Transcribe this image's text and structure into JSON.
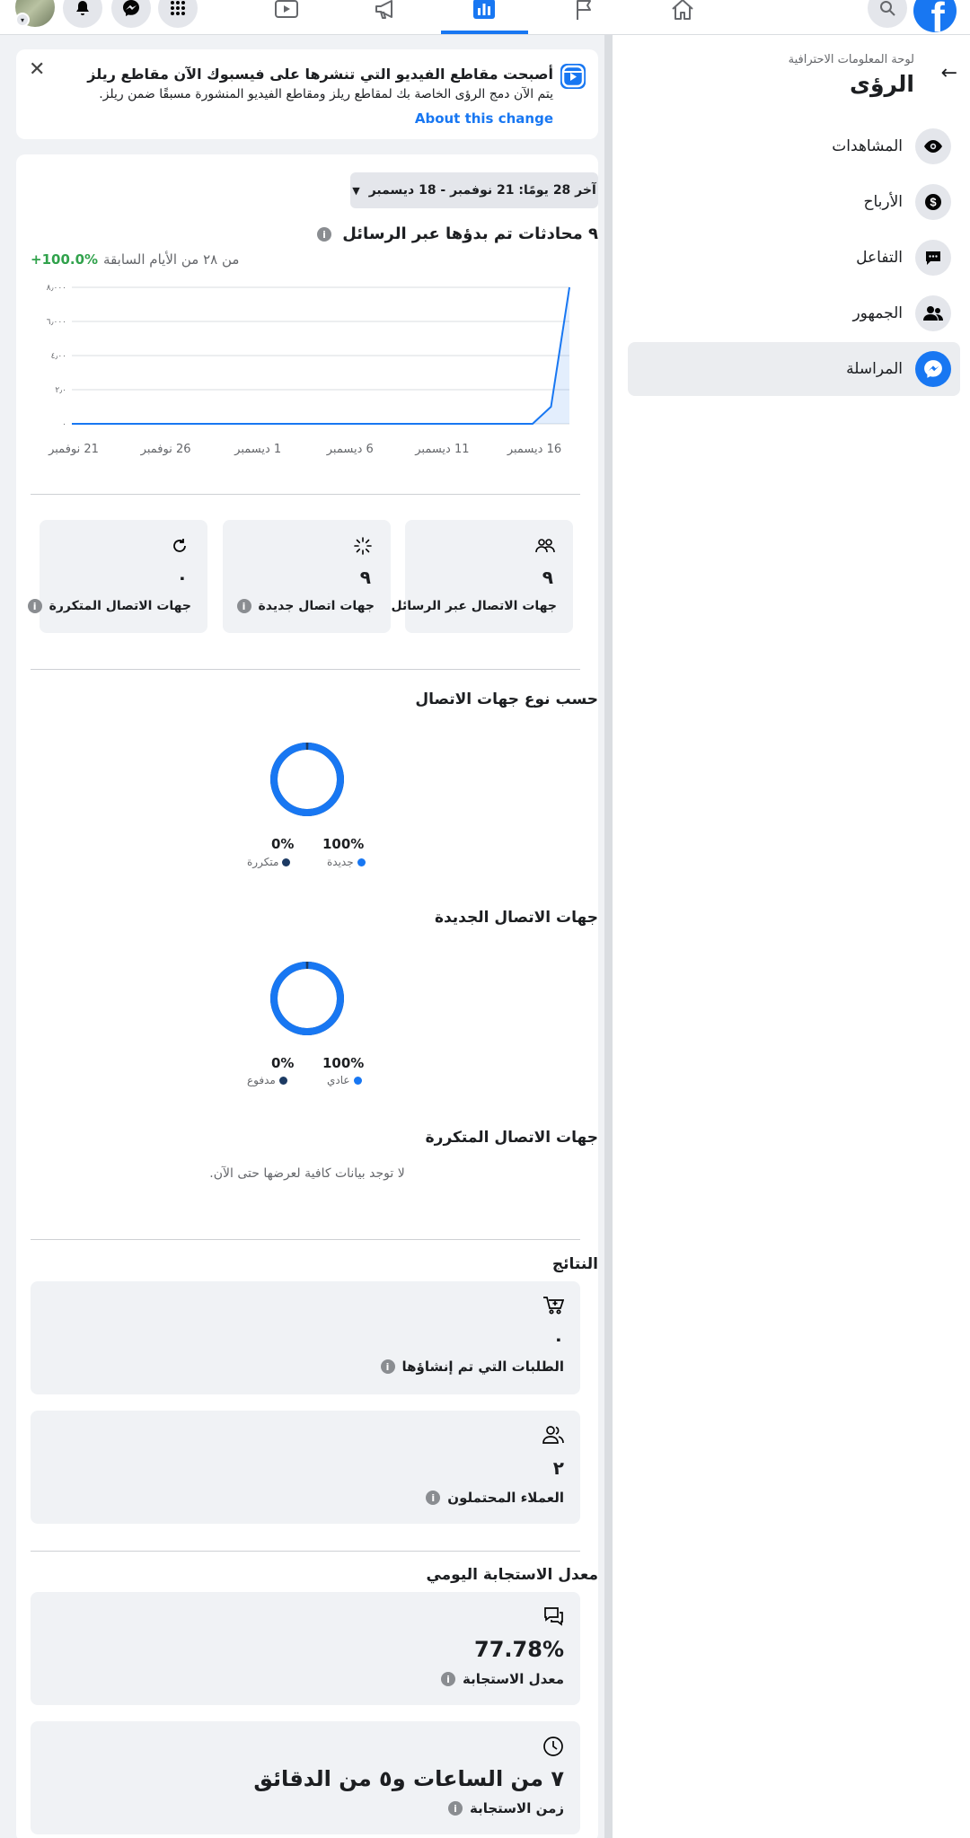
{
  "top_nav": {
    "logo": "f",
    "icons": [
      "search-icon",
      "home-icon",
      "flag-icon",
      "insights-icon",
      "megaphone-icon",
      "video-icon",
      "apps-grid-icon",
      "messenger-icon",
      "notifications-icon"
    ]
  },
  "sidebar": {
    "subtitle": "لوحة المعلومات الاحترافية",
    "title": "الرؤى",
    "items": [
      {
        "label": "المشاهدات",
        "icon": "eye-icon"
      },
      {
        "label": "الأرباح",
        "icon": "dollar-icon"
      },
      {
        "label": "التفاعل",
        "icon": "comment-icon"
      },
      {
        "label": "الجمهور",
        "icon": "people-icon"
      },
      {
        "label": "المراسلة",
        "icon": "messenger-icon"
      }
    ]
  },
  "banner": {
    "title": "أصبحت مقاطع الفيديو التي تنشرها على فيسبوك الآن مقاطع ريلز",
    "body": "يتم الآن دمج الرؤى الخاصة بك لمقاطع ريلز ومقاطع الفيديو المنشورة مسبقًا ضمن ريلز.",
    "link": "About this change"
  },
  "date_range": "آخر 28 يومًا: 21 نوفمبر - 18 ديسمبر",
  "conversations": {
    "title": "٩ محادثات تم بدؤها عبر الرسائل",
    "compare_label": "من ٢٨ من الأيام السابقة",
    "change": "+100.0%"
  },
  "chart_data": {
    "type": "line",
    "x": [
      "21 نوفمبر",
      "22",
      "23",
      "24",
      "25",
      "26 نوفمبر",
      "27",
      "28",
      "29",
      "30",
      "1 ديسمبر",
      "2",
      "3",
      "4",
      "5",
      "6 ديسمبر",
      "7",
      "8",
      "9",
      "10",
      "11 ديسمبر",
      "12",
      "13",
      "14",
      "15",
      "16 ديسمبر",
      "17",
      "18"
    ],
    "series": [
      {
        "values": [
          0,
          0,
          0,
          0,
          0,
          0,
          0,
          0,
          0,
          0,
          0,
          0,
          0,
          0,
          0,
          0,
          0,
          0,
          0,
          0,
          0,
          0,
          0,
          0,
          0,
          0,
          1,
          8
        ]
      }
    ],
    "ylim": [
      0,
      8
    ],
    "yticks": [
      "٨٫٠٠٠",
      "٦٫٠٠٠",
      "٤٫٠٠",
      "٢٫٠",
      "٠"
    ],
    "xticks": [
      "21 نوفمبر",
      "26 نوفمبر",
      "1 ديسمبر",
      "6 ديسمبر",
      "11 ديسمبر",
      "16 ديسمبر"
    ],
    "grid": true,
    "color": "#1877f2"
  },
  "stats": [
    {
      "label": "جهات الاتصال عبر الرسائل",
      "value": "٩",
      "icon": "people-group-icon"
    },
    {
      "label": "جهات اتصال جديدة",
      "value": "٩",
      "icon": "sparkle-icon"
    },
    {
      "label": "جهات الاتصال المتكررة",
      "value": "٠",
      "icon": "refresh-icon"
    }
  ],
  "by_contact_type": {
    "title": "حسب نوع جهات الاتصال",
    "new_pct": "100%",
    "new_label": "جديدة",
    "returning_pct": "0%",
    "returning_label": "متكررة",
    "new_fraction": 1.0
  },
  "new_contacts": {
    "title": "جهات الاتصال الجديدة",
    "organic_pct": "100%",
    "organic_label": "عادي",
    "paid_pct": "0%",
    "paid_label": "مدفوع",
    "organic_fraction": 1.0
  },
  "returning_contacts": {
    "title": "جهات الاتصال المتكررة",
    "empty_text": "لا توجد بيانات كافية لعرضها حتى الآن."
  },
  "results": {
    "title": "النتائج",
    "orders_value": "٠",
    "orders_label": "الطلبات التي تم إنشاؤها",
    "leads_value": "٢",
    "leads_label": "العملاء المحتملون"
  },
  "response": {
    "title": "معدل الاستجابة اليومي",
    "rate_value": "77.78%",
    "rate_label": "معدل الاستجابة",
    "time_value": "٧ من الساعات و٥ من الدقائق",
    "time_label": "زمن الاستجابة"
  },
  "colors": {
    "accent": "#1877f2",
    "dark_series": "#1c3a63",
    "positive": "#31a24c"
  }
}
